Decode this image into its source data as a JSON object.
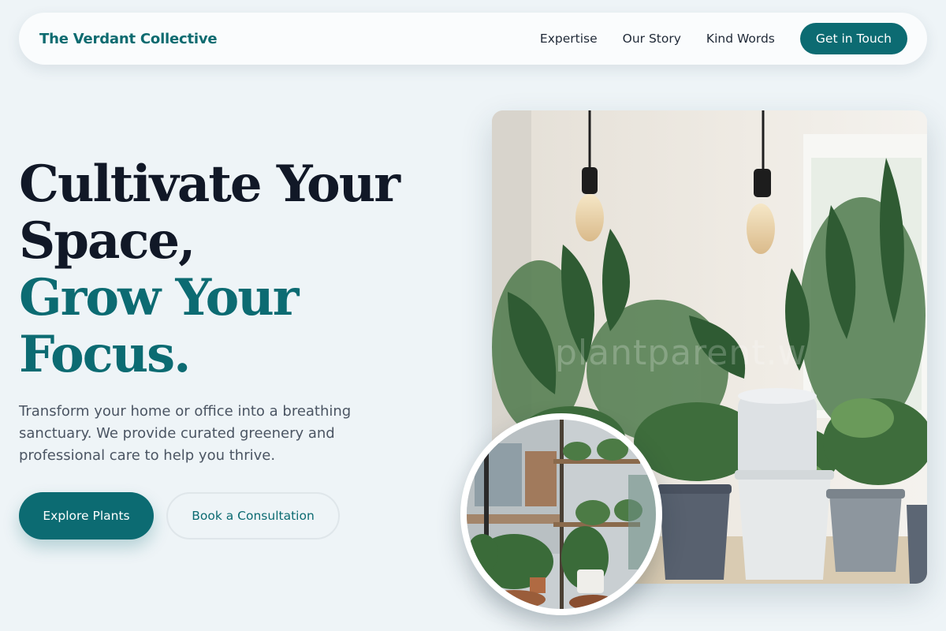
{
  "nav": {
    "brand": "The Verdant Collective",
    "links": [
      "Expertise",
      "Our Story",
      "Kind Words"
    ],
    "cta": "Get in Touch"
  },
  "hero": {
    "title_line1": "Cultivate Your",
    "title_line2": "Space,",
    "title_accent_line1": "Grow Your",
    "title_accent_line2": "Focus.",
    "subtitle": "Transform your home or office into a breathing sanctuary. We provide curated greenery and professional care to help you thrive.",
    "primary_cta": "Explore Plants",
    "secondary_cta": "Book a Consultation"
  },
  "images": {
    "main_watermark": "plantparent.w",
    "main_icon": "indoor-plants-photo",
    "inset_icon": "plant-shop-photo"
  },
  "colors": {
    "accent": "#0c6b72",
    "background": "#eef4f7",
    "heading": "#111827"
  }
}
